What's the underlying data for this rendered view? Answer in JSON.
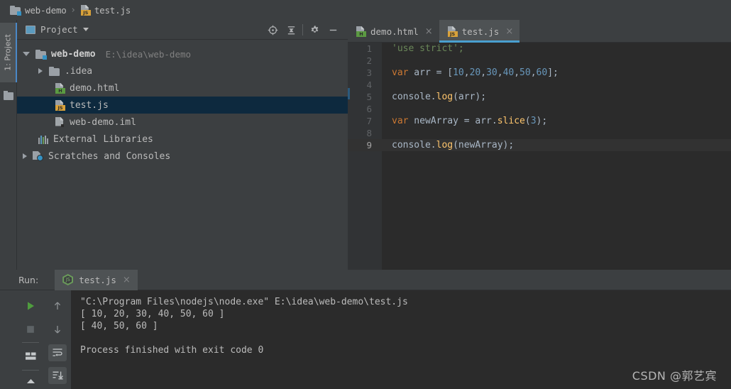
{
  "breadcrumb": {
    "project": "web-demo",
    "file": "test.js",
    "separator": "›"
  },
  "left_tool_strip": {
    "project_tab": "1: Project",
    "folder_icon": "folder-icon"
  },
  "project_panel": {
    "title": "Project",
    "dropdown_icon": "chevron-down-icon",
    "actions": [
      {
        "name": "locate-icon",
        "label": "Select Opened File"
      },
      {
        "name": "collapse-all-icon",
        "label": "Collapse All"
      },
      {
        "name": "gear-icon",
        "label": "Settings"
      },
      {
        "name": "minimize-icon",
        "label": "Hide"
      }
    ],
    "tree": [
      {
        "label": "web-demo",
        "detail": "E:\\idea\\web-demo",
        "icon": "module-folder-icon",
        "indent": 0,
        "arrow": "open",
        "bold": true,
        "selected": false
      },
      {
        "label": ".idea",
        "detail": "",
        "icon": "folder-icon",
        "indent": 1,
        "arrow": "closed",
        "bold": false,
        "selected": false
      },
      {
        "label": "demo.html",
        "detail": "",
        "icon": "html-file-icon",
        "indent": 1,
        "arrow": "none",
        "bold": false,
        "selected": false
      },
      {
        "label": "test.js",
        "detail": "",
        "icon": "js-file-icon",
        "indent": 1,
        "arrow": "none",
        "bold": false,
        "selected": true
      },
      {
        "label": "web-demo.iml",
        "detail": "",
        "icon": "iml-file-icon",
        "indent": 1,
        "arrow": "none",
        "bold": false,
        "selected": false
      },
      {
        "label": "External Libraries",
        "detail": "",
        "icon": "libraries-icon",
        "indent": 0,
        "arrow": "none",
        "bold": false,
        "selected": false
      },
      {
        "label": "Scratches and Consoles",
        "detail": "",
        "icon": "scratches-icon",
        "indent": 0,
        "arrow": "closed",
        "bold": false,
        "selected": false
      }
    ]
  },
  "editor": {
    "tabs": [
      {
        "label": "demo.html",
        "icon": "html-file-icon",
        "active": false,
        "close": "×"
      },
      {
        "label": "test.js",
        "icon": "js-file-icon",
        "active": true,
        "close": "×"
      }
    ],
    "current_line": 9,
    "lines": [
      {
        "no": "1",
        "tokens": [
          {
            "t": "'use strict';",
            "c": "tk-str"
          }
        ]
      },
      {
        "no": "2",
        "tokens": []
      },
      {
        "no": "3",
        "tokens": [
          {
            "t": "var",
            "c": "tk-kw"
          },
          {
            "t": " arr = [",
            "c": "tk-pn"
          },
          {
            "t": "10",
            "c": "tk-num"
          },
          {
            "t": ",",
            "c": "tk-pn"
          },
          {
            "t": "20",
            "c": "tk-num"
          },
          {
            "t": ",",
            "c": "tk-pn"
          },
          {
            "t": "30",
            "c": "tk-num"
          },
          {
            "t": ",",
            "c": "tk-pn"
          },
          {
            "t": "40",
            "c": "tk-num"
          },
          {
            "t": ",",
            "c": "tk-pn"
          },
          {
            "t": "50",
            "c": "tk-num"
          },
          {
            "t": ",",
            "c": "tk-pn"
          },
          {
            "t": "60",
            "c": "tk-num"
          },
          {
            "t": "];",
            "c": "tk-pn"
          }
        ]
      },
      {
        "no": "4",
        "tokens": []
      },
      {
        "no": "5",
        "tokens": [
          {
            "t": "console.",
            "c": "tk-pn"
          },
          {
            "t": "log",
            "c": "tk-fn"
          },
          {
            "t": "(arr);",
            "c": "tk-pn"
          }
        ]
      },
      {
        "no": "6",
        "tokens": []
      },
      {
        "no": "7",
        "tokens": [
          {
            "t": "var",
            "c": "tk-kw"
          },
          {
            "t": " newArray = arr.",
            "c": "tk-pn"
          },
          {
            "t": "slice",
            "c": "tk-fn"
          },
          {
            "t": "(",
            "c": "tk-pn"
          },
          {
            "t": "3",
            "c": "tk-num"
          },
          {
            "t": ");",
            "c": "tk-pn"
          }
        ]
      },
      {
        "no": "8",
        "tokens": []
      },
      {
        "no": "9",
        "tokens": [
          {
            "t": "console.",
            "c": "tk-pn"
          },
          {
            "t": "log",
            "c": "tk-fn"
          },
          {
            "t": "(newArray);",
            "c": "tk-pn"
          }
        ]
      }
    ]
  },
  "run_panel": {
    "label": "Run:",
    "tab": {
      "label": "test.js",
      "icon": "nodejs-icon",
      "close": "×"
    },
    "buttons": [
      {
        "name": "rerun-button",
        "label": "Rerun"
      },
      {
        "name": "stop-button",
        "label": "Stop"
      },
      {
        "name": "layout-button",
        "label": "Layout"
      },
      {
        "name": "pin-button",
        "label": "Pin"
      },
      {
        "name": "up-stacktrace-button",
        "label": "Up the Stack Trace"
      },
      {
        "name": "down-stacktrace-button",
        "label": "Down the Stack Trace"
      },
      {
        "name": "soft-wrap-button",
        "label": "Soft-Wrap"
      },
      {
        "name": "scroll-to-end-button",
        "label": "Scroll to the End"
      }
    ],
    "output": [
      "\"C:\\Program Files\\nodejs\\node.exe\" E:\\idea\\web-demo\\test.js",
      "[ 10, 20, 30, 40, 50, 60 ]",
      "[ 40, 50, 60 ]",
      "",
      "Process finished with exit code 0"
    ]
  },
  "watermark": "CSDN @郭艺宾",
  "colors": {
    "chrome": "#3C3F41",
    "editor_bg": "#2B2B2B",
    "gutter_bg": "#313335",
    "tab_active": "#4E5254",
    "tab_underline": "#4A9FD0",
    "tree_selection": "#0D293E",
    "text": "#BBBBBB",
    "keyword": "#CC7832",
    "string": "#6A8759",
    "number": "#6897BB",
    "function": "#FFC66D",
    "default_code": "#A9B7C6",
    "run_green": "#5B9A42"
  }
}
